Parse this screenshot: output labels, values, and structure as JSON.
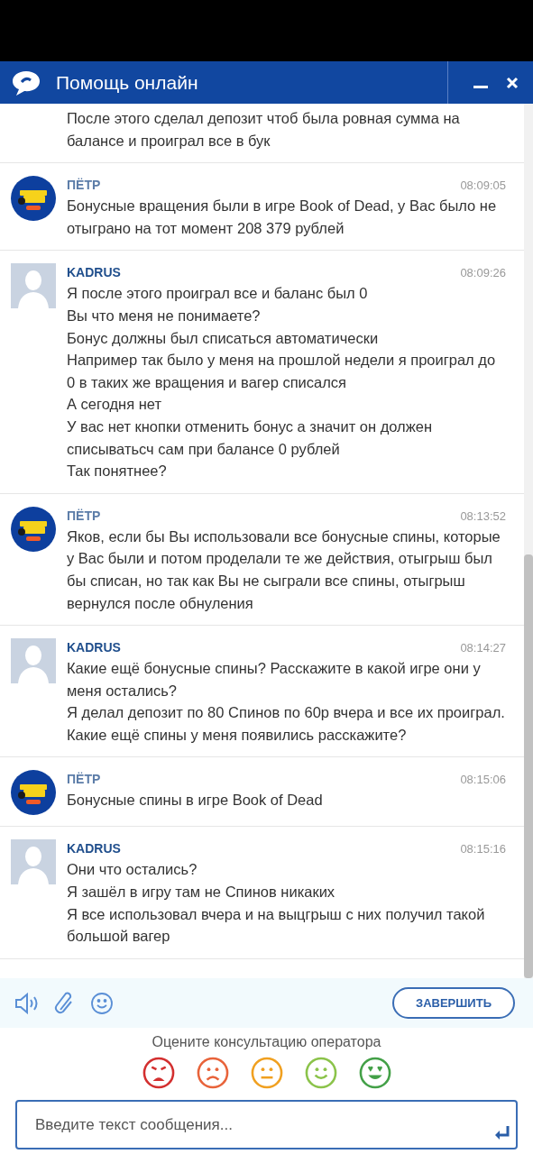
{
  "header": {
    "title": "Помощь онлайн"
  },
  "messages": [
    {
      "kind": "continuation",
      "lines": [
        "После этого сделал депозит чтоб была ровная сумма на",
        "балансе и проиграл все в бук"
      ]
    },
    {
      "kind": "operator",
      "author": "ПЁТР",
      "time": "08:09:05",
      "lines": [
        "Бонусные вращения были в игре Book of Dead, у Вас было не отыграно на тот момент 208 379 рублей"
      ]
    },
    {
      "kind": "user",
      "author": "KADRUS",
      "time": "08:09:26",
      "lines": [
        "Я после этого проиграл все и баланс был 0",
        "Вы что меня не понимаете?",
        "Бонус должны был списаться автоматически",
        "Например так было у меня на прошлой недели я проиграл до 0 в таких же вращения и вагер списался",
        "А сегодня нет",
        "У вас нет кнопки отменить бонус а значит он должен списыватьсч сам при балансе 0 рублей",
        "Так понятнее?"
      ]
    },
    {
      "kind": "operator",
      "author": "ПЁТР",
      "time": "08:13:52",
      "lines": [
        "Яков, если бы Вы использовали все бонусные спины, которые у Вас были и потом проделали те же действия, отыгрыш был бы списан, но так как Вы не сыграли все спины, отыгрыш вернулся после обнуления"
      ]
    },
    {
      "kind": "user",
      "author": "KADRUS",
      "time": "08:14:27",
      "lines": [
        "Какие ещё бонусные спины? Расскажите в какой игре они у меня остались?",
        "Я делал депозит по 80 Спинов по 60р вчера и все их проиграл. Какие ещё спины у меня появились расскажите?"
      ]
    },
    {
      "kind": "operator",
      "author": "ПЁТР",
      "time": "08:15:06",
      "lines": [
        "Бонусные спины в игре Book of Dead"
      ]
    },
    {
      "kind": "user",
      "author": "KADRUS",
      "time": "08:15:16",
      "lines": [
        "Они что остались?",
        "Я зашёл в игру там не Спинов никаких",
        "Я все использовал вчера и на выцгрыш с них получил такой большой вагер"
      ]
    }
  ],
  "toolbar": {
    "finish_button": "ЗАВЕРШИТЬ"
  },
  "rating": {
    "prompt": "Оцените консультацию оператора",
    "faces": [
      {
        "kind": "angry",
        "color": "#d32f2f"
      },
      {
        "kind": "sad",
        "color": "#e8633a"
      },
      {
        "kind": "neutral",
        "color": "#f0a020"
      },
      {
        "kind": "smile",
        "color": "#8bc34a"
      },
      {
        "kind": "love",
        "color": "#43a047"
      }
    ]
  },
  "composer": {
    "placeholder": "Введите текст сообщения..."
  }
}
